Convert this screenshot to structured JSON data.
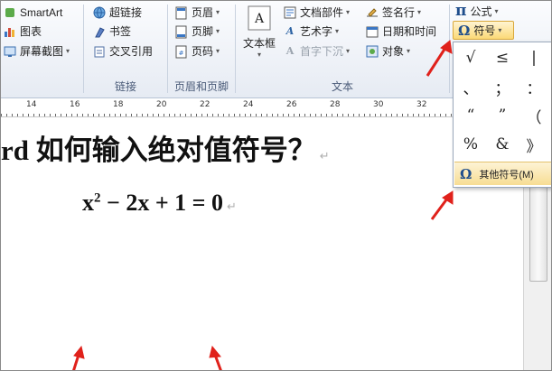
{
  "ribbon": {
    "illustrations": {
      "smartart": "SmartArt",
      "chart": "图表",
      "screenshot": "屏幕截图"
    },
    "links": {
      "hyperlink": "超链接",
      "bookmark": "书签",
      "cross_reference": "交叉引用",
      "group_label": "链接"
    },
    "header_footer": {
      "header": "页眉",
      "footer": "页脚",
      "page_number": "页码",
      "group_label": "页眉和页脚"
    },
    "text": {
      "text_box": "文本框",
      "quick_parts": "文档部件",
      "wordart": "艺术字",
      "drop_cap": "首字下沉",
      "signature_line": "签名行",
      "date_time": "日期和时间",
      "object": "对象",
      "group_label": "文本"
    },
    "symbols": {
      "equation": "公式",
      "symbol": "符号"
    }
  },
  "ruler": {
    "labels": [
      "14",
      "16",
      "18",
      "20",
      "22",
      "24",
      "26",
      "28",
      "30",
      "32"
    ]
  },
  "symbol_panel": {
    "symbols": [
      "√",
      "≤",
      "|",
      "、",
      "；",
      "：",
      "“",
      "”",
      "（",
      "%",
      "&",
      "》"
    ],
    "more_symbols": "其他符号(M)"
  },
  "document": {
    "heading": "rd 如何输入绝对值符号？",
    "equation": {
      "term1": "x",
      "exp": "2",
      "rest": " − 2x + 1 = 0"
    }
  },
  "colors": {
    "ribbon_bg": "#e6ebf3",
    "highlight": "#f7dd93",
    "accent": "#1f4e8c",
    "arrow": "#e0211b"
  }
}
